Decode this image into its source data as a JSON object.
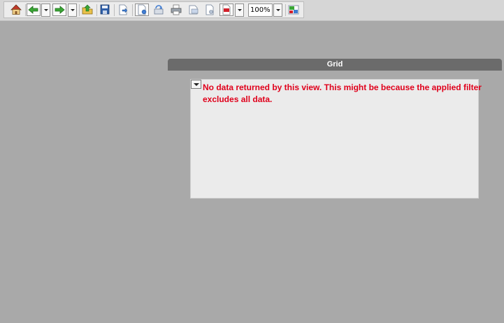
{
  "toolbar": {
    "buttons": [
      {
        "name": "home-button",
        "icon": "home-icon"
      },
      {
        "name": "back-button",
        "icon": "arrow-left-icon"
      },
      {
        "name": "forward-button",
        "icon": "arrow-right-icon"
      },
      {
        "name": "up-folder-button",
        "icon": "folder-up-icon"
      },
      {
        "name": "save-button",
        "icon": "floppy-disk-icon"
      },
      {
        "name": "export-button",
        "icon": "export-icon"
      },
      {
        "name": "new-document-button",
        "icon": "new-document-icon"
      },
      {
        "name": "refresh-button",
        "icon": "refresh-icon"
      },
      {
        "name": "print-button",
        "icon": "printer-icon"
      },
      {
        "name": "print-preview-button",
        "icon": "print-preview-icon"
      },
      {
        "name": "page-setup-button",
        "icon": "page-setup-icon"
      },
      {
        "name": "pdf-export-button",
        "icon": "pdf-icon"
      },
      {
        "name": "fit-window-button",
        "icon": "fit-window-icon"
      }
    ],
    "zoom_value": "100%"
  },
  "grid_panel": {
    "title": "Grid",
    "message": "No data returned by this view. This might be because the applied filter excludes all data."
  },
  "colors": {
    "background": "#a9a9a9",
    "header": "#6b6b6b",
    "message": "#e0001b"
  }
}
